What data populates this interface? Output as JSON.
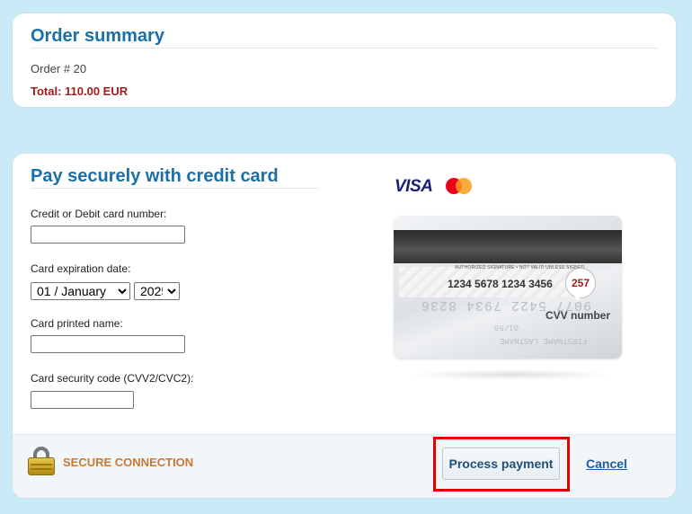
{
  "order_summary": {
    "title": "Order summary",
    "order_number": "Order # 20",
    "total": "Total: 110.00 EUR"
  },
  "payment": {
    "title": "Pay securely with credit card",
    "card_number_label": "Credit or Debit card number:",
    "card_number_value": "",
    "expiration_label": "Card expiration date:",
    "expiration_month": "01 / January",
    "expiration_year": "2025",
    "printed_name_label": "Card printed name:",
    "printed_name_value": "",
    "security_code_label": "Card security code (CVV2/CVC2):",
    "security_code_value": ""
  },
  "card_illustration": {
    "brand_visa": "VISA",
    "signature_note": "AUTHORIZED SIGNATURE • NOT VALID UNLESS SIGNED",
    "card_number": "1234 5678 1234 3456",
    "cvv": "257",
    "cvv_label": "CVV number",
    "embossed_number": "9077 5422 7934 8236",
    "embossed_date": "01/50",
    "embossed_name": "FIRSTNAME LASTNAME"
  },
  "footer": {
    "secure_text": "SECURE CONNECTION",
    "process_button": "Process payment",
    "cancel_link": "Cancel"
  },
  "colors": {
    "background": "#c9ebf8",
    "heading": "#1b6fa8",
    "total": "#a21d1d",
    "secure": "#c67a34",
    "highlight": "#e00000"
  }
}
